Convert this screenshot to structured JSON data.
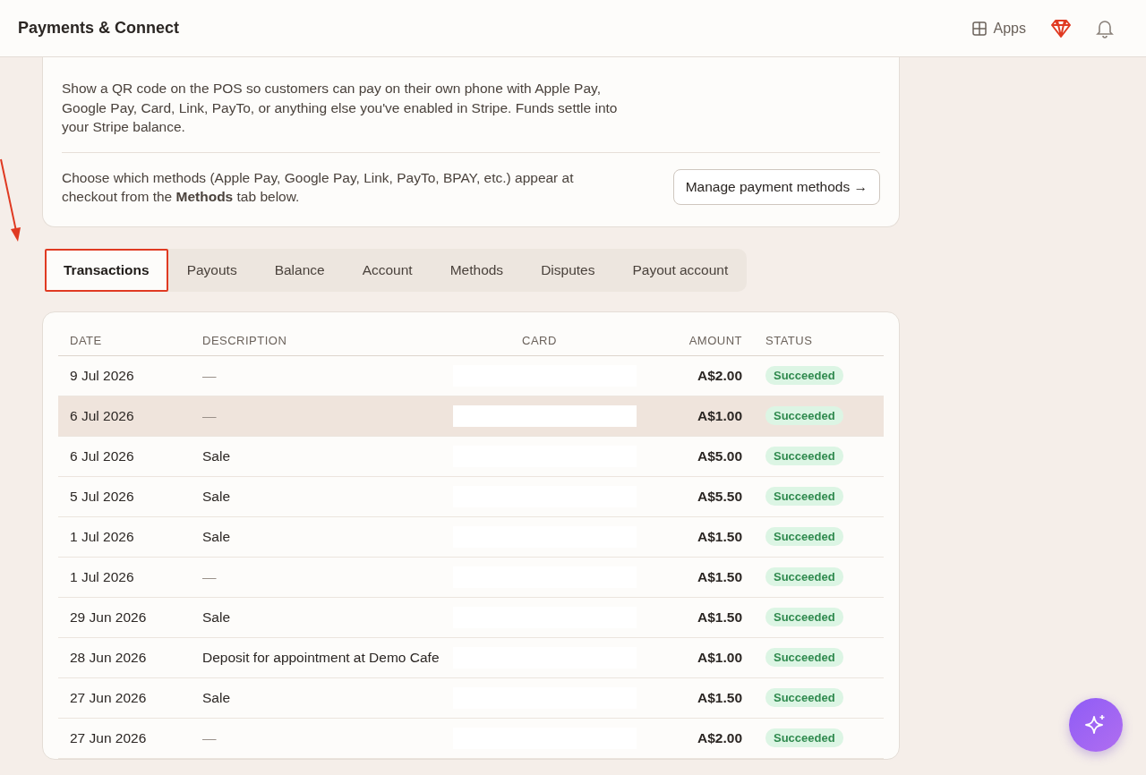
{
  "header": {
    "title": "Payments & Connect",
    "apps_label": "Apps"
  },
  "qr_card": {
    "description": "Show a QR code on the POS so customers can pay on their own phone with Apple Pay, Google Pay, Card, Link, PayTo, or anything else you've enabled in Stripe. Funds settle into your Stripe balance.",
    "methods_note": "Choose which methods (Apple Pay, Google Pay, Link, PayTo, BPAY, etc.) appear at checkout from the **Methods** tab below.",
    "manage_button": "Manage payment methods →"
  },
  "tabs": [
    {
      "label": "Transactions",
      "selected": true,
      "annotated": true
    },
    {
      "label": "Payouts",
      "selected": false,
      "annotated": false
    },
    {
      "label": "Balance",
      "selected": false,
      "annotated": false
    },
    {
      "label": "Account",
      "selected": false,
      "annotated": false
    },
    {
      "label": "Methods",
      "selected": false,
      "annotated": false
    },
    {
      "label": "Disputes",
      "selected": false,
      "annotated": false
    },
    {
      "label": "Payout account",
      "selected": false,
      "annotated": false
    }
  ],
  "table": {
    "columns": [
      "DATE",
      "DESCRIPTION",
      "CARD",
      "AMOUNT",
      "STATUS"
    ],
    "rows": [
      {
        "date": "9 Jul 2026",
        "description": "—",
        "amount": "A$2.00",
        "status": "Succeeded",
        "highlighted": false
      },
      {
        "date": "6 Jul 2026",
        "description": "—",
        "amount": "A$1.00",
        "status": "Succeeded",
        "highlighted": true
      },
      {
        "date": "6 Jul 2026",
        "description": "Sale",
        "amount": "A$5.00",
        "status": "Succeeded",
        "highlighted": false
      },
      {
        "date": "5 Jul 2026",
        "description": "Sale",
        "amount": "A$5.50",
        "status": "Succeeded",
        "highlighted": false
      },
      {
        "date": "1 Jul 2026",
        "description": "Sale",
        "amount": "A$1.50",
        "status": "Succeeded",
        "highlighted": false
      },
      {
        "date": "1 Jul 2026",
        "description": "—",
        "amount": "A$1.50",
        "status": "Succeeded",
        "highlighted": false
      },
      {
        "date": "29 Jun 2026",
        "description": "Sale",
        "amount": "A$1.50",
        "status": "Succeeded",
        "highlighted": false
      },
      {
        "date": "28 Jun 2026",
        "description": "Deposit for appointment at Demo Cafe",
        "amount": "A$1.00",
        "status": "Succeeded",
        "highlighted": false
      },
      {
        "date": "27 Jun 2026",
        "description": "Sale",
        "amount": "A$1.50",
        "status": "Succeeded",
        "highlighted": false
      },
      {
        "date": "27 Jun 2026",
        "description": "—",
        "amount": "A$2.00",
        "status": "Succeeded",
        "highlighted": false
      }
    ]
  }
}
